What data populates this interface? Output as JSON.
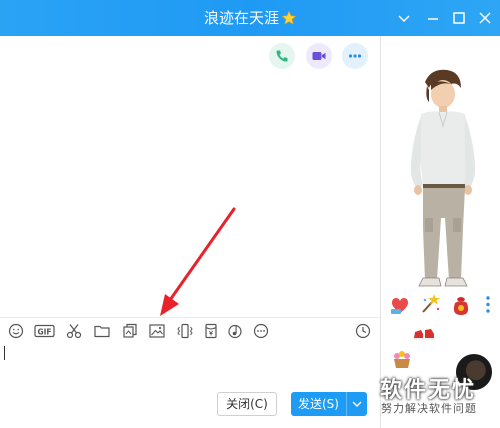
{
  "window": {
    "title": "浪迹在天涯",
    "accent_color": "#1f9af4",
    "controls": [
      "chevron-down-icon",
      "minimize-icon",
      "maximize-icon",
      "close-icon"
    ]
  },
  "top_actions": [
    "phone-icon",
    "video-icon",
    "more-icon"
  ],
  "toolbar": {
    "tools": [
      "emoji-icon",
      "gif-icon",
      "scissors-icon",
      "folder-icon",
      "sticker-icon",
      "image-icon",
      "shake-icon",
      "red-packet-icon",
      "music-icon",
      "more-icon",
      "history-clock-icon"
    ],
    "gif_label": "GIF"
  },
  "buttons": {
    "close_label": "关闭(C)",
    "send_label": "发送(S)"
  },
  "watermark": {
    "title": "软件无忧",
    "subtitle": "努力解决软件问题"
  }
}
